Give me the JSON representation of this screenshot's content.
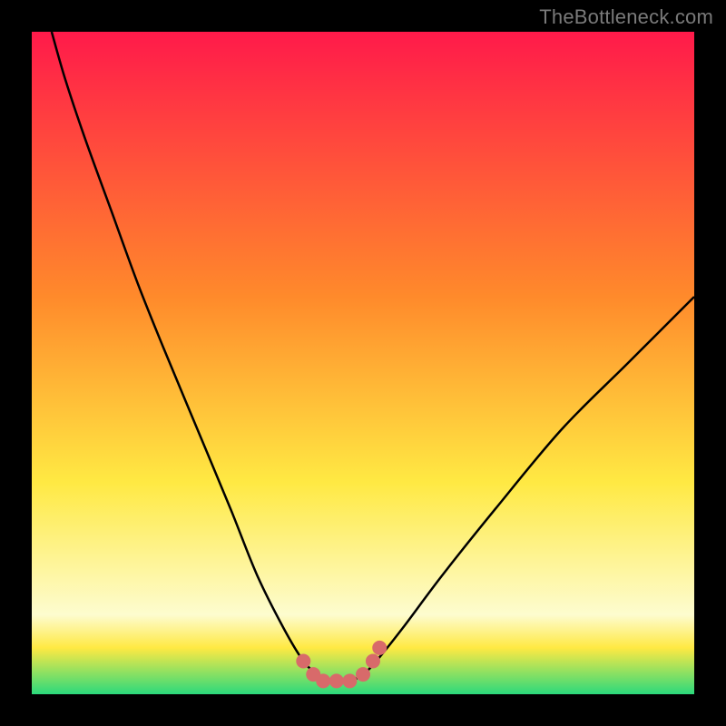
{
  "watermark": "TheBottleneck.com",
  "colors": {
    "frame": "#000000",
    "grad_top": "#ff1a4a",
    "grad_mid1": "#ff8a2b",
    "grad_mid2": "#ffe943",
    "grad_mid3": "#fdfccf",
    "grad_bottom": "#2bd97c",
    "curve": "#000000",
    "marker": "#d86a6a"
  },
  "chart_data": {
    "type": "line",
    "title": "",
    "xlabel": "",
    "ylabel": "",
    "xlim": [
      0,
      100
    ],
    "ylim": [
      0,
      100
    ],
    "series": [
      {
        "name": "bottleneck-curve",
        "x": [
          3,
          5,
          8,
          12,
          16,
          20,
          25,
          30,
          34,
          38,
          41,
          43,
          44,
          46,
          48,
          50,
          52,
          56,
          62,
          70,
          80,
          90,
          100
        ],
        "y": [
          100,
          93,
          84,
          73,
          62,
          52,
          40,
          28,
          18,
          10,
          5,
          3,
          2,
          2,
          2,
          3,
          5,
          10,
          18,
          28,
          40,
          50,
          60
        ]
      }
    ],
    "markers": {
      "name": "highlight-dots",
      "x": [
        41,
        42.5,
        44,
        46,
        48,
        50,
        51.5,
        52.5
      ],
      "y": [
        5,
        3,
        2,
        2,
        2,
        3,
        5,
        7
      ]
    }
  }
}
